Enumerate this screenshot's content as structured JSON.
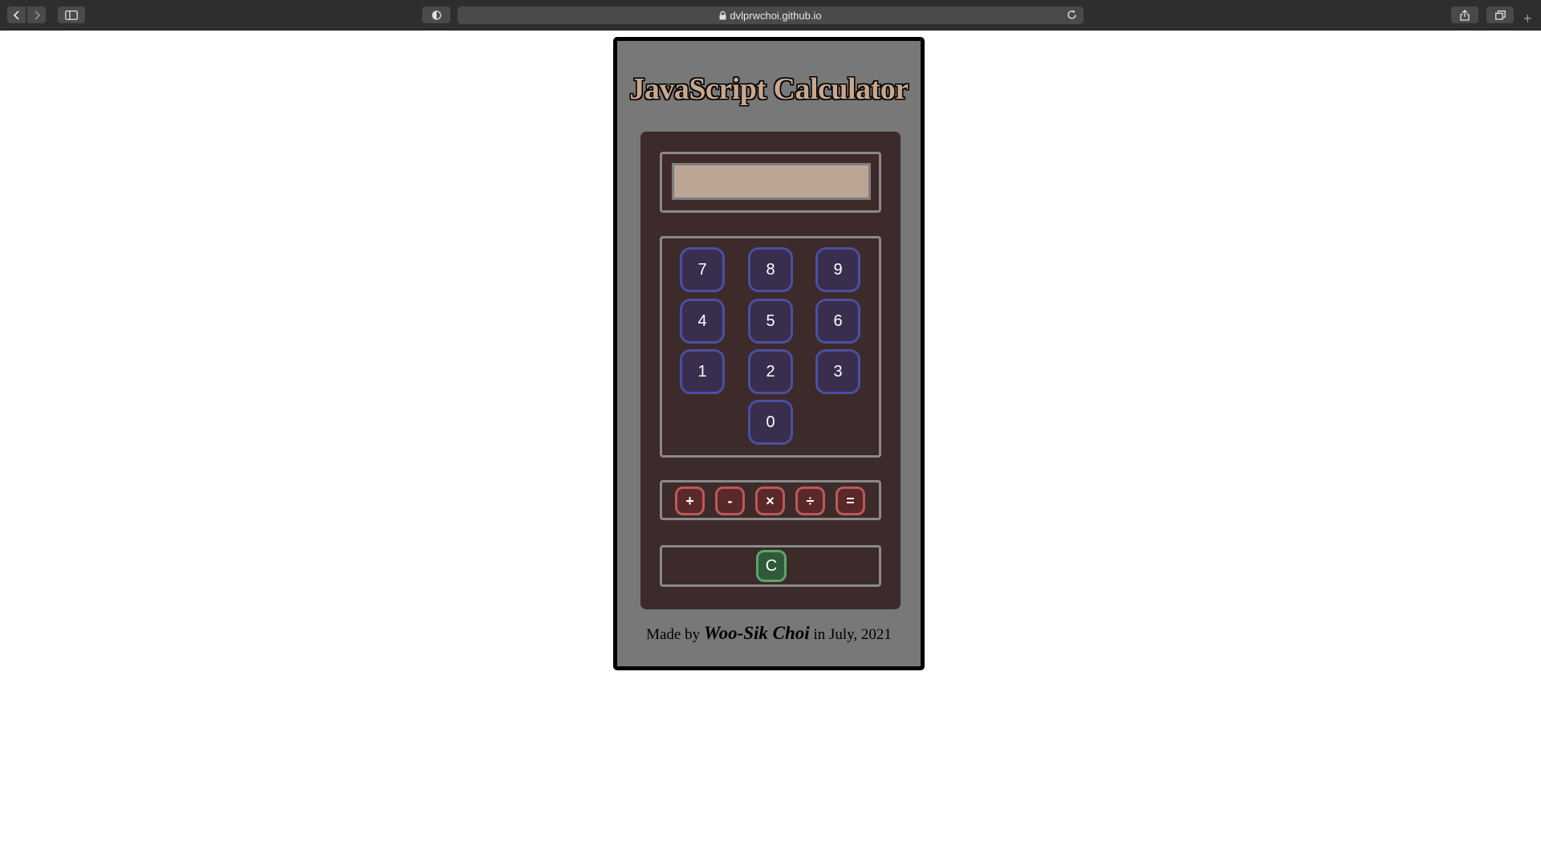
{
  "browser": {
    "url": "dvlprwchoi.github.io",
    "icons": {
      "back": "chevron-left-icon",
      "forward": "chevron-right-icon",
      "sidebar": "sidebar-icon",
      "privacy": "privacy-shield-icon",
      "lock": "lock-icon",
      "reload": "reload-icon",
      "share": "share-icon",
      "tabs": "tabs-overview-icon",
      "new_tab": "plus-icon"
    }
  },
  "calculator": {
    "title": "JavaScript Calculator",
    "display_value": "",
    "number_keys": {
      "k7": "7",
      "k8": "8",
      "k9": "9",
      "k4": "4",
      "k5": "5",
      "k6": "6",
      "k1": "1",
      "k2": "2",
      "k3": "3",
      "k0": "0"
    },
    "operator_keys": {
      "add": "+",
      "subtract": "-",
      "multiply": "×",
      "divide": "÷",
      "equals": "="
    },
    "clear_key": "C",
    "footer": {
      "prefix": "Made by ",
      "author": "Woo-Sik Choi",
      "suffix": " in July, 2021"
    },
    "colors": {
      "card_bg": "#787878",
      "body_bg": "#3d2a2a",
      "display_bg": "#bca594",
      "number_border": "#4a50a0",
      "operator_border": "#b85a5a",
      "clear_border": "#5ea36a"
    }
  }
}
